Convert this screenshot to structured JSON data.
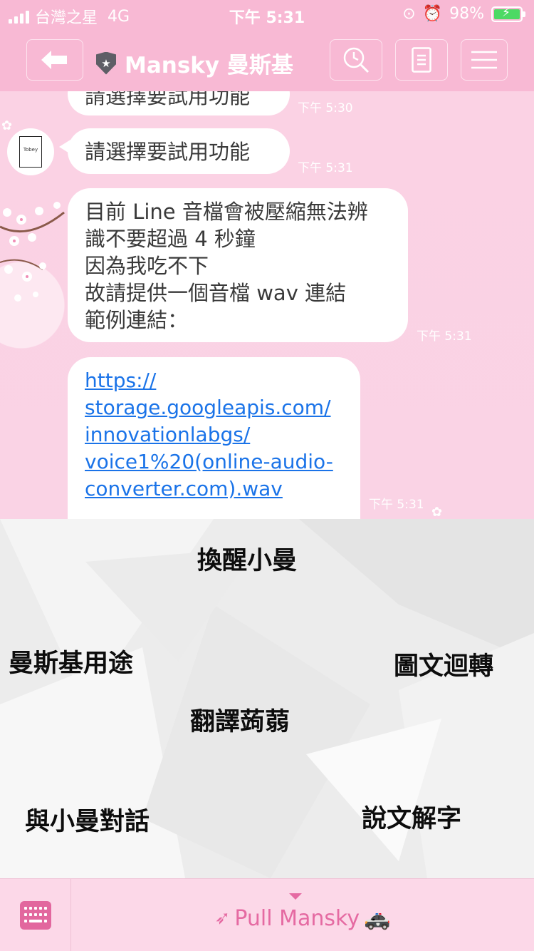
{
  "status_bar": {
    "carrier": "台灣之星",
    "network": "4G",
    "time": "下午 5:31",
    "battery": "98%"
  },
  "header": {
    "title": "Mansky 曼斯基"
  },
  "messages": [
    {
      "text_lines": [
        "請選擇要試用功能"
      ],
      "time": "下午 5:30"
    },
    {
      "text_lines": [
        "請選擇要試用功能"
      ],
      "time": "下午 5:31"
    },
    {
      "text_lines": [
        "目前 Line 音檔會被壓縮無法辨",
        "識不要超過 4 秒鐘",
        "因為我吃不下",
        "故請提供一個音檔 wav 連結",
        "範例連結："
      ],
      "time": "下午 5:31"
    },
    {
      "link_lines": [
        "https://",
        "storage.googleapis.com/",
        "innovationlabgs/",
        "voice1%20(online-audio-",
        "converter.com).wav"
      ],
      "time": "下午 5:31"
    }
  ],
  "avatar": {
    "label": "Tobey"
  },
  "rich_menu": {
    "items": [
      "換醒小曼",
      "曼斯基用途",
      "圖文迴轉",
      "翻譯蒟蒻",
      "說文解字",
      "與小曼對話"
    ]
  },
  "bottom_bar": {
    "menu_label": "Pull Mansky"
  },
  "colors": {
    "header_pink": "#f8b9d4",
    "chat_bg": "#fbd2e4",
    "link": "#1a73e8",
    "accent": "#e56aa2"
  }
}
